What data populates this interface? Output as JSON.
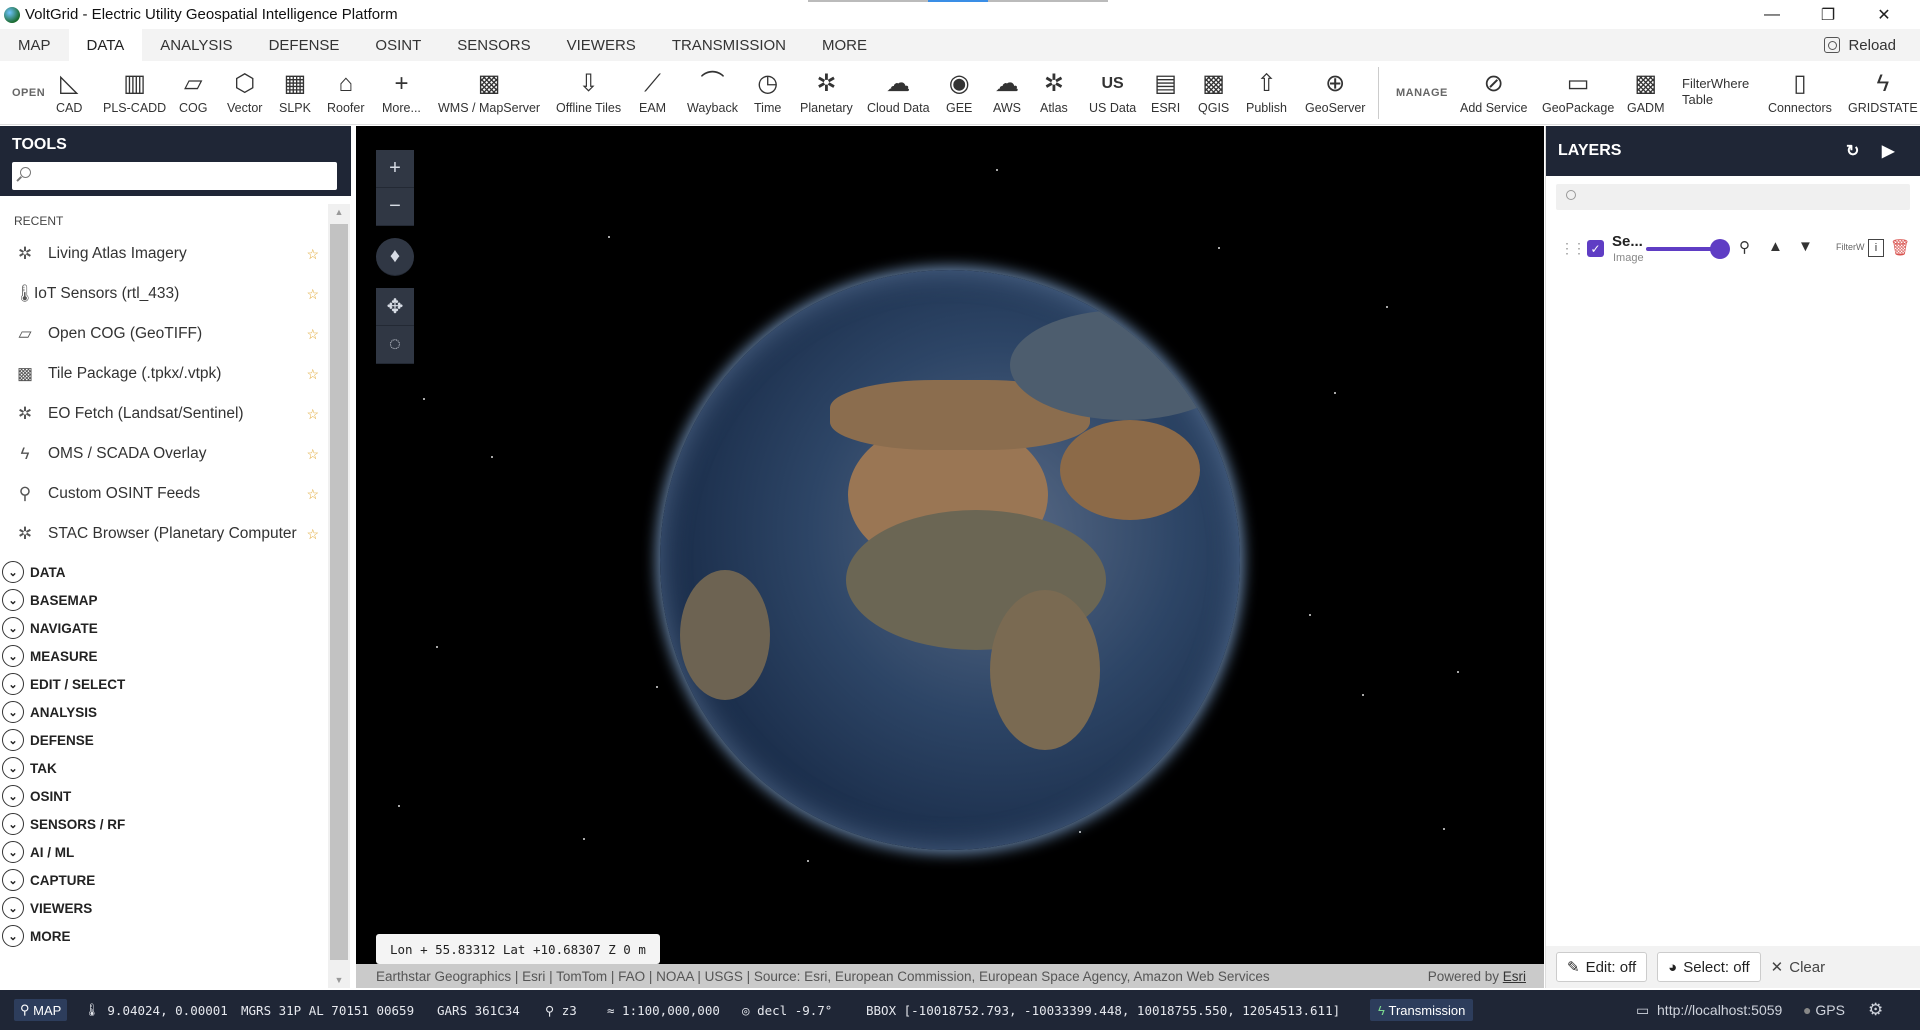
{
  "window": {
    "title": "VoltGrid - Electric Utility Geospatial Intelligence Platform",
    "minimize": "—",
    "restore": "❐",
    "close": "✕"
  },
  "menu": {
    "tabs": [
      "MAP",
      "DATA",
      "ANALYSIS",
      "DEFENSE",
      "OSINT",
      "SENSORS",
      "VIEWERS",
      "TRANSMISSION",
      "MORE"
    ],
    "active": "DATA",
    "reload": "Reload"
  },
  "ribbon": {
    "open_label": "OPEN",
    "manage_label": "MANAGE",
    "items": [
      {
        "label": "CAD",
        "icon": "cad-icon"
      },
      {
        "label": "PLS-CADD",
        "icon": "pls-cadd-icon"
      },
      {
        "label": "COG",
        "icon": "cog-file-icon"
      },
      {
        "label": "Vector",
        "icon": "vector-icon"
      },
      {
        "label": "SLPK",
        "icon": "slpk-icon"
      },
      {
        "label": "Roofer",
        "icon": "roofer-icon"
      },
      {
        "label": "More...",
        "icon": "plus-icon"
      },
      {
        "label": "WMS / MapServer",
        "icon": "wms-icon"
      },
      {
        "label": "Offline Tiles",
        "icon": "offline-tiles-icon"
      },
      {
        "label": "EAM",
        "icon": "eam-icon"
      },
      {
        "label": "Wayback",
        "icon": "wayback-icon"
      },
      {
        "label": "Time",
        "icon": "time-icon"
      },
      {
        "label": "Planetary",
        "icon": "planetary-icon"
      },
      {
        "label": "Cloud Data",
        "icon": "cloud-data-icon"
      },
      {
        "label": "GEE",
        "icon": "gee-icon"
      },
      {
        "label": "AWS",
        "icon": "aws-icon"
      },
      {
        "label": "Atlas",
        "icon": "atlas-icon"
      },
      {
        "label": "US Data",
        "icon": "us-data-icon",
        "glyph": "US"
      },
      {
        "label": "ESRI",
        "icon": "esri-icon"
      },
      {
        "label": "QGIS",
        "icon": "qgis-icon"
      },
      {
        "label": "Publish",
        "icon": "publish-icon"
      },
      {
        "label": "GeoServer",
        "icon": "geoserver-icon"
      },
      {
        "label": "Add Service",
        "icon": "add-service-icon"
      },
      {
        "label": "GeoPackage",
        "icon": "geopackage-icon"
      },
      {
        "label": "GADM",
        "icon": "gadm-icon"
      },
      {
        "label": "Connectors",
        "icon": "connectors-icon"
      },
      {
        "label": "GRIDSTATE",
        "icon": "gridstate-icon"
      }
    ],
    "filterwhere_line1": "FilterWhere",
    "filterwhere_line2": "Table"
  },
  "tools": {
    "title": "TOOLS",
    "search_placeholder": "",
    "recent_label": "RECENT",
    "recent": [
      {
        "label": "Living Atlas Imagery",
        "icon": "satellite-icon"
      },
      {
        "label": "IoT Sensors (rtl_433)",
        "icon": "thermometer-icon"
      },
      {
        "label": "Open COG (GeoTIFF)",
        "icon": "cog-file-icon"
      },
      {
        "label": "Tile Package (.tpkx/.vtpk)",
        "icon": "tile-package-icon"
      },
      {
        "label": "EO Fetch (Landsat/Sentinel)",
        "icon": "satellite-icon"
      },
      {
        "label": "OMS / SCADA Overlay",
        "icon": "lightning-icon"
      },
      {
        "label": "Custom OSINT Feeds",
        "icon": "feed-icon"
      },
      {
        "label": "STAC Browser (Planetary Computer",
        "icon": "satellite-icon"
      }
    ],
    "sections": [
      "DATA",
      "BASEMAP",
      "NAVIGATE",
      "MEASURE",
      "EDIT / SELECT",
      "ANALYSIS",
      "DEFENSE",
      "TAK",
      "OSINT",
      "SENSORS / RF",
      "AI / ML",
      "CAPTURE",
      "VIEWERS",
      "MORE"
    ]
  },
  "map": {
    "coords": "Lon + 55.83312   Lat +10.68307   Z 0 m",
    "attribution": "Earthstar Geographics | Esri | TomTom | FAO | NOAA | USGS | Source: Esri, European Commission, European Space Agency, Amazon Web Services",
    "powered_by": "Powered by",
    "powered_link": "Esri"
  },
  "layers": {
    "title": "LAYERS",
    "search_placeholder": "",
    "items": [
      {
        "name": "Se...",
        "type": "Image",
        "opacity": 1.0,
        "filter_label": "FilterW",
        "visible": true
      }
    ],
    "edit_btn": "Edit: off",
    "select_btn": "Select: off",
    "clear_btn": "Clear"
  },
  "status": {
    "map_badge": "MAP",
    "lonlat": "9.04024, 0.00001",
    "mgrs": "MGRS 31P AL 70151 00659",
    "gars": "GARS 361C34",
    "zoom": "z3",
    "scale": "≈ 1:100,000,000",
    "decl": "decl -9.7°",
    "bbox": "BBOX [-10018752.793, -10033399.448, 10018755.550, 12054513.611]",
    "transmission": "Transmission",
    "server": "http://localhost:5059",
    "gps": "GPS"
  },
  "colors": {
    "panel_dark": "#1f2636",
    "accent": "#5f3dc4",
    "star": "#e0a52e"
  }
}
